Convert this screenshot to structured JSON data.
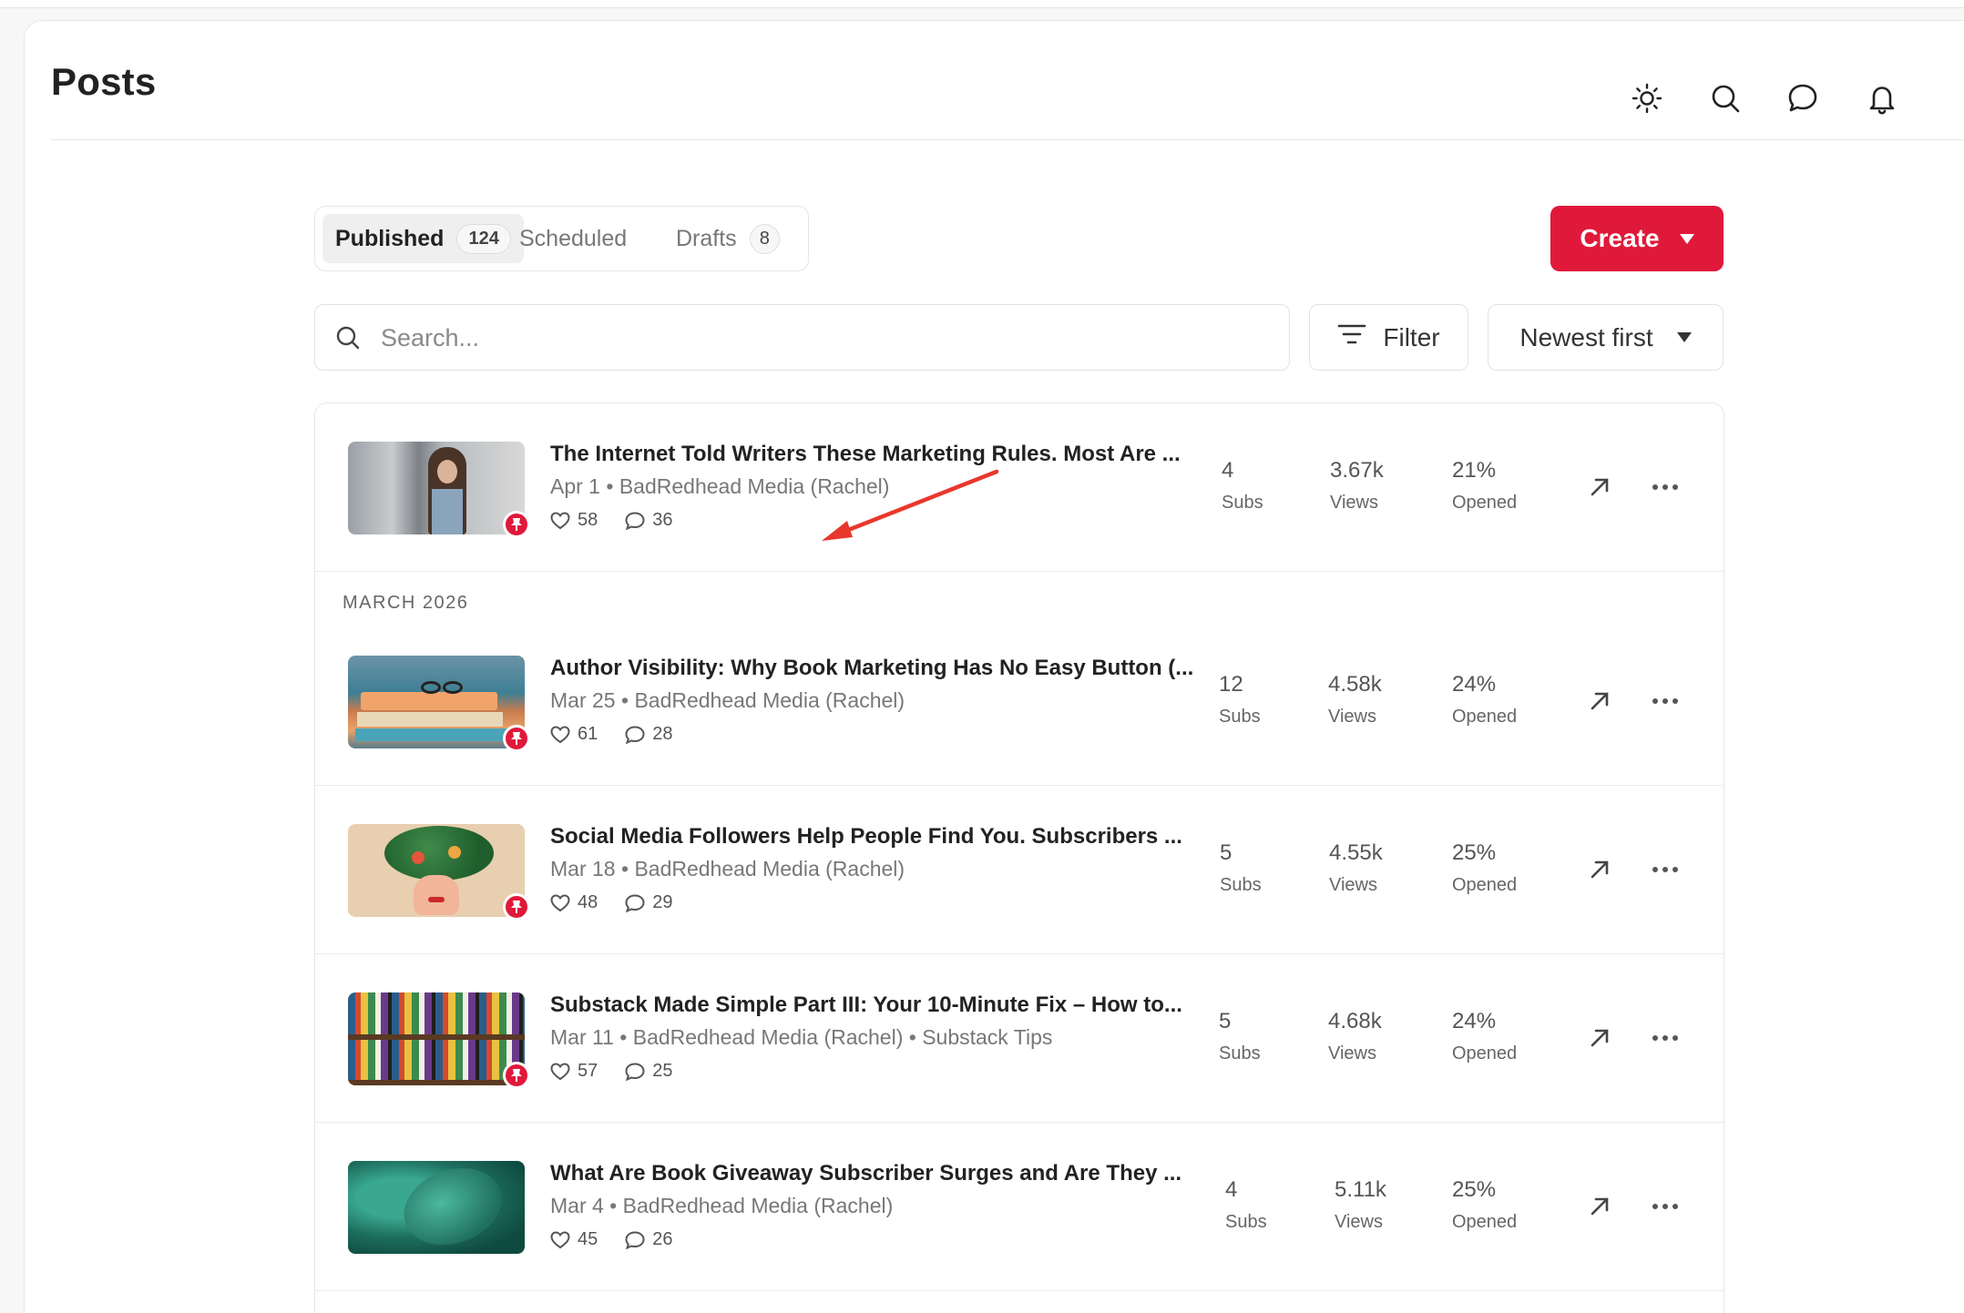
{
  "header": {
    "title": "Posts",
    "icons": [
      "sun-icon",
      "search-icon",
      "chat-icon",
      "bell-icon"
    ]
  },
  "tabs": [
    {
      "label": "Published",
      "count": "124",
      "active": true
    },
    {
      "label": "Scheduled",
      "count": "",
      "active": false
    },
    {
      "label": "Drafts",
      "count": "8",
      "active": false
    }
  ],
  "create": {
    "label": "Create"
  },
  "search": {
    "placeholder": "Search..."
  },
  "filter": {
    "label": "Filter"
  },
  "sort": {
    "label": "Newest first"
  },
  "sections": [
    {
      "month": "MARCH 2026"
    }
  ],
  "posts": [
    {
      "title": "The Internet Told Writers These Marketing Rules. Most Are ...",
      "date": "Apr 1",
      "author": "BadRedhead Media (Rachel)",
      "section": "",
      "likes": "58",
      "comments": "36",
      "subs": "4",
      "views": "3.67k",
      "opened": "21%",
      "pinned": true
    },
    {
      "title": "Author Visibility: Why Book Marketing Has No Easy Button (...",
      "date": "Mar 25",
      "author": "BadRedhead Media (Rachel)",
      "section": "",
      "likes": "61",
      "comments": "28",
      "subs": "12",
      "views": "4.58k",
      "opened": "24%",
      "pinned": true
    },
    {
      "title": "Social Media Followers Help People Find You. Subscribers ...",
      "date": "Mar 18",
      "author": "BadRedhead Media (Rachel)",
      "section": "",
      "likes": "48",
      "comments": "29",
      "subs": "5",
      "views": "4.55k",
      "opened": "25%",
      "pinned": true
    },
    {
      "title": "Substack Made Simple Part III: Your 10-Minute Fix – How to...",
      "date": "Mar 11",
      "author": "BadRedhead Media (Rachel)",
      "section": "Substack Tips",
      "likes": "57",
      "comments": "25",
      "subs": "5",
      "views": "4.68k",
      "opened": "24%",
      "pinned": true
    },
    {
      "title": "What Are Book Giveaway Subscriber Surges and Are They ...",
      "date": "Mar 4",
      "author": "BadRedhead Media (Rachel)",
      "section": "",
      "likes": "45",
      "comments": "26",
      "subs": "4",
      "views": "5.11k",
      "opened": "25%",
      "pinned": false
    }
  ],
  "stat_labels": {
    "subs": "Subs",
    "views": "Views",
    "opened": "Opened"
  },
  "colors": {
    "accent": "#e0193b",
    "annotation": "#e8382c"
  }
}
